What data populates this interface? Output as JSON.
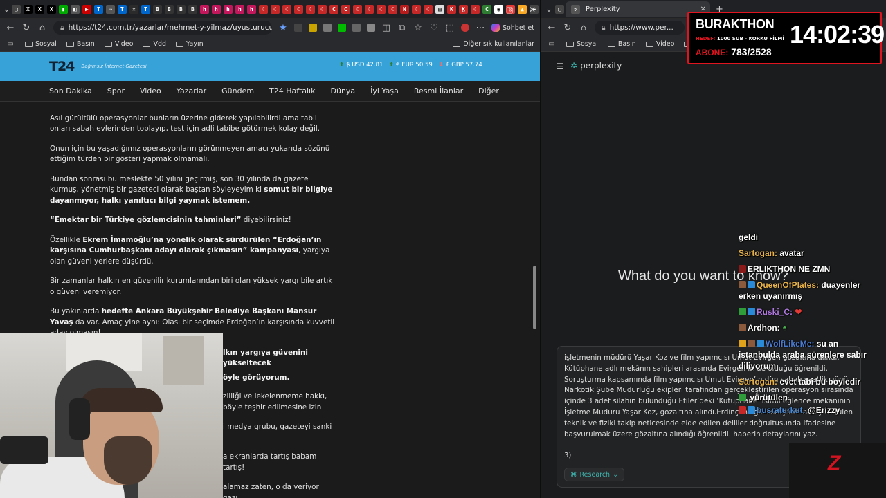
{
  "left_browser": {
    "url": "https://t24.com.tr/yazarlar/mehmet-y-yilmaz/uyusturucu-o...",
    "chat_button": "Sohbet et",
    "bookmarks": [
      "Sosyal",
      "Basın",
      "Video",
      "Vdd",
      "Yayın"
    ],
    "other_bookmarks": "Diğer sık kullanılanlar",
    "tab_icons": [
      "X",
      "X",
      "X",
      "T24",
      "B",
      "B",
      "B",
      "C",
      "C",
      "K",
      "K",
      "X"
    ]
  },
  "site": {
    "logo": "T24",
    "slogan": "Bağımsız İnternet Gazetesi",
    "usd": "$ USD 42.81",
    "eur": "€ EUR 50.59",
    "gbp": "£ GBP 57.74",
    "nav": [
      "Son Dakika",
      "Spor",
      "Video",
      "Yazarlar",
      "Gündem",
      "T24 Haftalık",
      "Dünya",
      "İyi Yaşa",
      "Resmi İlanlar",
      "Diğer"
    ]
  },
  "article": {
    "p1": "Asıl gürültülü operasyonlar bunların üzerine giderek yapılabilirdi ama tabii onları sabah evlerinden toplayıp, test için adli tabibe götürmek kolay değil.",
    "p2": "Onun için bu yaşadığımız operasyonların görünmeyen amacı yukarıda sözünü ettiğim türden bir gösteri yapmak olmamalı.",
    "p3a": "Bundan sonrası bu meslekte 50 yılını geçirmiş, son 30 yılında da gazete kurmuş, yönetmiş bir gazeteci olarak baştan söyleyeyim ki ",
    "p3b": "somut bir bilgiye dayanmıyor, halkı yanıltıcı bilgi yaymak istemem.",
    "p4a": "“Emektar bir Türkiye gözlemcisinin tahminleri”",
    "p4b": " diyebilirsiniz!",
    "p5a": "Özellikle ",
    "p5b": "Ekrem İmamoğlu’na yönelik olarak sürdürülen “Erdoğan’ın karşısına Cumhurbaşkanı adayı olarak çıkmasın” kampanyası",
    "p5c": ", yargıya olan güveni yerlere düşürdü.",
    "p6": "Bir zamanlar halkın en güvenilir kurumlarından biri olan yüksek yargı bile artık o güveni veremiyor.",
    "p7a": "Bu yakınlarda ",
    "p7b": "hedefte Ankara Büyükşehir Belediye Başkanı Mansur Yavaş",
    "p7c": " da var. Amaç yine aynı: Olası bir seçimde Erdoğan’ın karşısında kuvvetli aday olmasın!",
    "p8": "lkın yargıya güvenini yükseltecek",
    "p9": "öyle görüyorum.",
    "p10a": "zliliği ve lekelenmeme hakkı,",
    "p10b": "böyle teşhir edilmesine izin",
    "p11": "i medya grubu, gazeteyi sanki",
    "p12": "a ekranlarda tartış babam tartış!",
    "p13": "alamaz zaten, o da veriyor gazı."
  },
  "right_browser": {
    "tab_title": "Perplexity",
    "url": "https://www.per...",
    "bookmarks": [
      "Sosyal",
      "Basın",
      "Video",
      "Vd"
    ]
  },
  "perplexity": {
    "logo": "perplexity",
    "question": "What do you want to know?",
    "query": "işletmenin müdürü Yaşar Koz ve film yapımcısı Umut Evirgen gözaltına alındı. Kütüphane adlı mekânın sahipleri arasında Evirgen’in de olduğu öğrenildi. Soruşturma kapsamında film yapımcısı Umut Evirgen’in dün sabah saatlik günü Narkotik Şube Müdürlüğü ekipleri tarafından gerçekleştirilen operasyon sırasında içinde 3 adet silahın bulunduğu Etiler’deki ‘Kütüphane’ isimli eğlence mekanının İşletme Müdürü Yaşar Koz, gözaltına alındı.Erdinç’in ilgili soruşturmada yürütülen teknik ve fiziki takip neticesinde elde edilen deliller doğrultusunda ifadesine başvurulmak üzere gözaltına alındığı öğrenildi. haberin detaylarını yaz.",
    "q3": "3)",
    "research": "Research"
  },
  "chat": [
    {
      "user": "",
      "text": "geldi",
      "color": "#ffffff"
    },
    {
      "user": "Sartogan:",
      "text": " avatar",
      "color": "#e8b34b"
    },
    {
      "user": "",
      "text": "ERLIKTHON NE ZMN",
      "color": "#d22"
    },
    {
      "user": "QueenOfPlates:",
      "text": " duayenler erken uyanırmış",
      "color": "#e8b34b"
    },
    {
      "user": "Ruski_C:",
      "text": " ❤",
      "color": "#b07ae0"
    },
    {
      "user": "Ardhon:",
      "text": " ",
      "color": "#e8e8e8"
    },
    {
      "user": "WolfLikeMe:",
      "text": " su an istanbulda araba sürenlere sabır diliyorum",
      "color": "#4a7bd0"
    },
    {
      "user": "Sartogan:",
      "text": " evet tabi bu boyledir",
      "color": "#e8b34b"
    },
    {
      "user": "",
      "text": " yürütülen",
      "color": "#fff"
    },
    {
      "user": "busraturkut:",
      "text": " @Erizzy",
      "color": "#4a8bd8"
    }
  ],
  "overlay": {
    "title": "BURAKTHON",
    "hedef_label": "HEDEF:",
    "hedef": "1000 SUB - KORKU FİLMİ",
    "abone_label": "ABONE:",
    "abone": "783/2528",
    "clock": "14:02:39"
  },
  "colors": {
    "t24_blue": "#36a2d8",
    "perplexity_teal": "#3fb6b1",
    "overlay_red": "#e0141e"
  }
}
